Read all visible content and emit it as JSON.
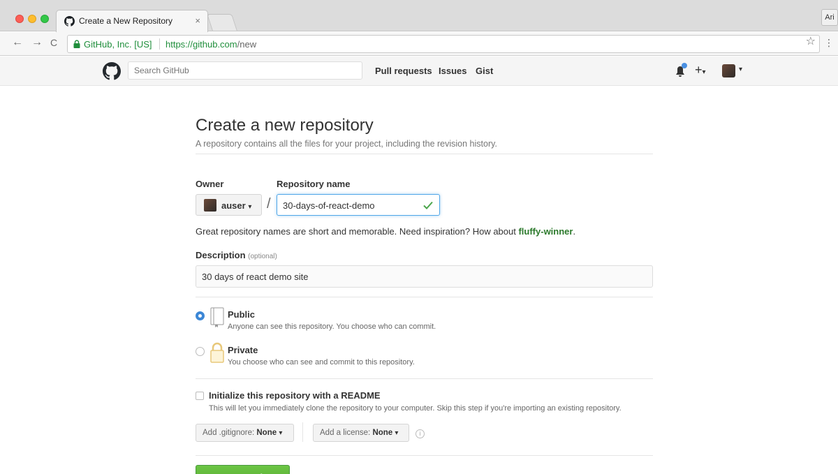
{
  "browser": {
    "tab_title": "Create a New Repository",
    "tab_close": "×",
    "profile": "Ari",
    "secure_label": "GitHub, Inc. [US]",
    "url_host": "https://github.com",
    "url_path": "/new",
    "back": "←",
    "forward": "→",
    "reload": "C",
    "star": "☆",
    "menu": "⋮"
  },
  "header": {
    "search_placeholder": "Search GitHub",
    "nav": [
      "Pull requests",
      "Issues",
      "Gist"
    ],
    "plus": "+",
    "caret": "▾"
  },
  "page": {
    "title": "Create a new repository",
    "subtitle": "A repository contains all the files for your project, including the revision history."
  },
  "form": {
    "owner_label": "Owner",
    "owner_value": "auser",
    "slash": "/",
    "repo_label": "Repository name",
    "repo_value": "30-days-of-react-demo",
    "hint_prefix": "Great repository names are short and memorable. Need inspiration? How about ",
    "hint_suggestion": "fluffy-winner",
    "hint_suffix": ".",
    "description_label": "Description",
    "description_optional": "(optional)",
    "description_value": "30 days of react demo site",
    "visibility": [
      {
        "title": "Public",
        "desc": "Anyone can see this repository. You choose who can commit.",
        "checked": true
      },
      {
        "title": "Private",
        "desc": "You choose who can see and commit to this repository.",
        "checked": false
      }
    ],
    "readme_title": "Initialize this repository with a README",
    "readme_desc": "This will let you immediately clone the repository to your computer. Skip this step if you're importing an existing repository.",
    "gitignore_label": "Add .gitignore:",
    "gitignore_value": "None",
    "license_label": "Add a license:",
    "license_value": "None",
    "info": "i",
    "create_button": "Create repository"
  },
  "colors": {
    "accent_blue": "#3c87d6",
    "success_green": "#2c7a2c",
    "create_green": "#55a532"
  }
}
